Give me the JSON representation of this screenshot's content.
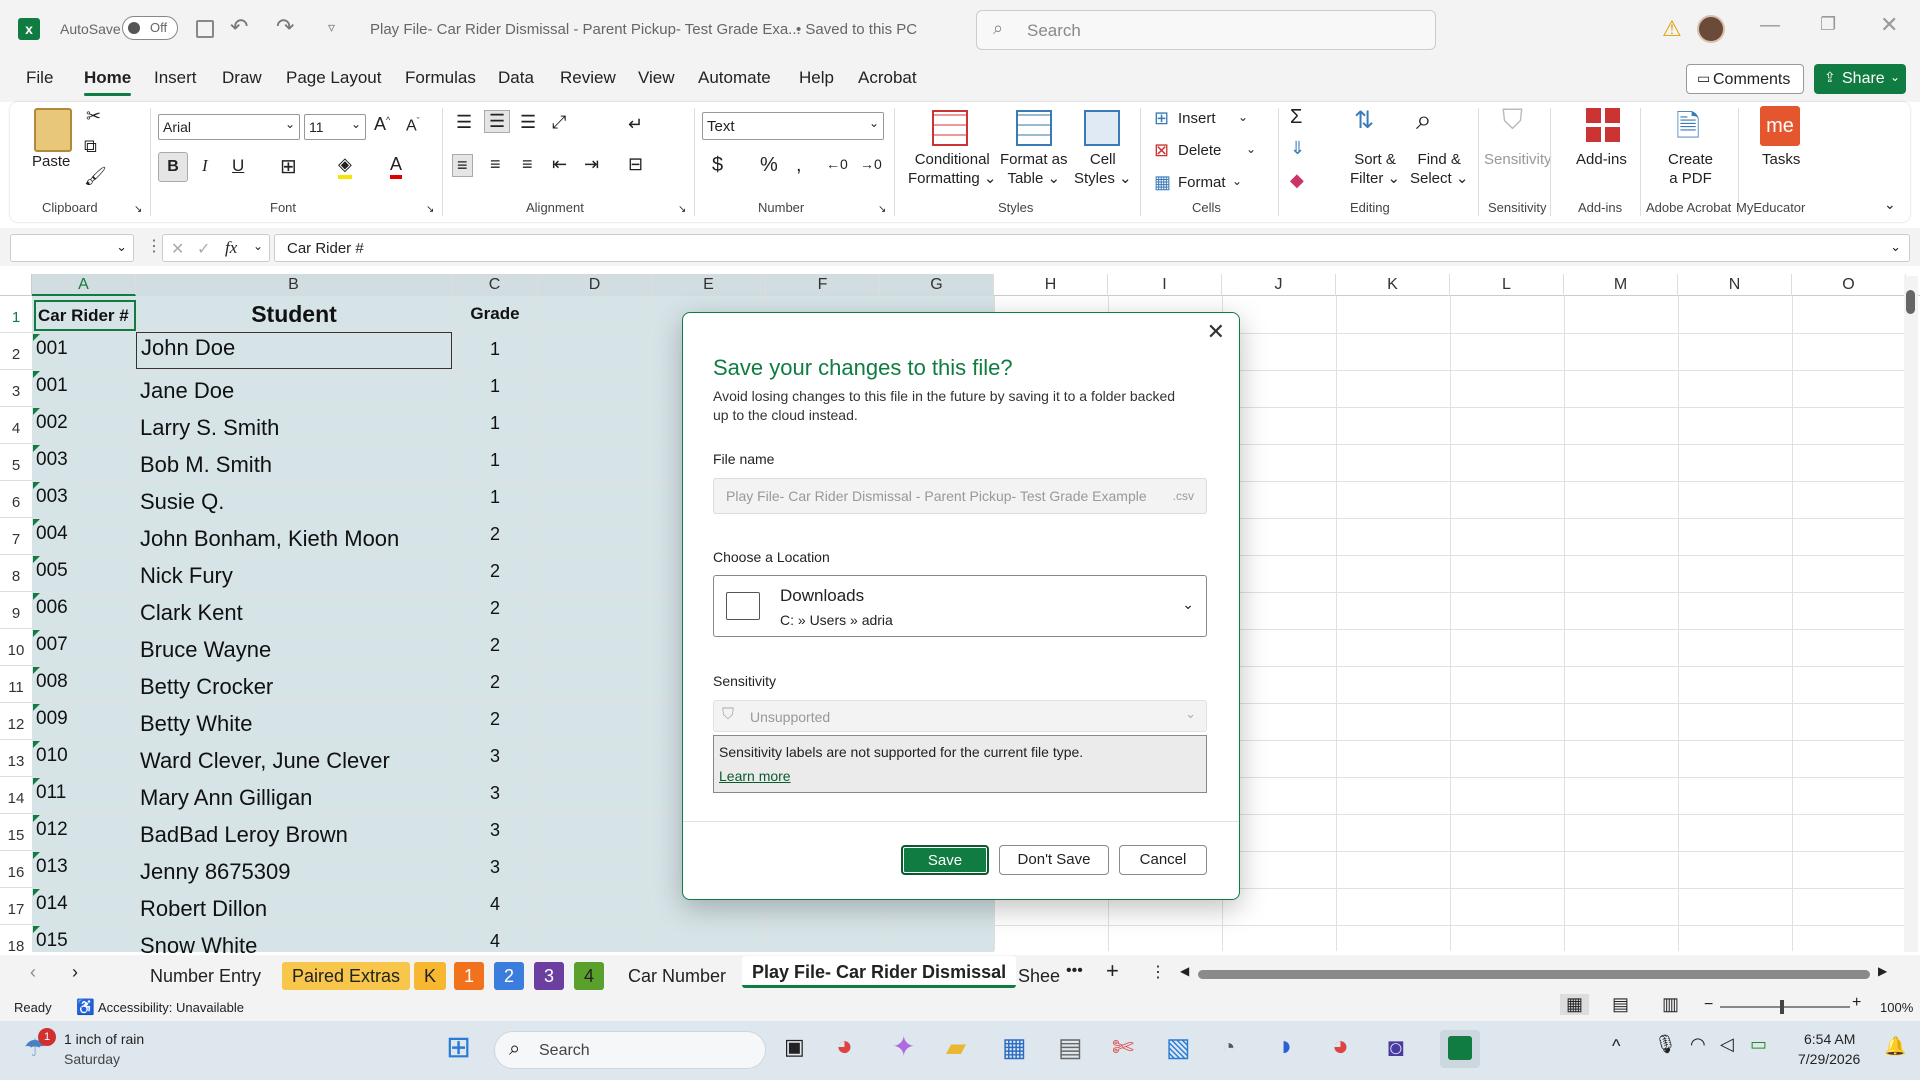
{
  "titlebar": {
    "autosave_label": "AutoSave",
    "autosave_state": "Off",
    "doc_title": "Play File- Car Rider Dismissal - Parent Pickup- Test Grade Exa...",
    "save_state": "• Saved to this PC",
    "search_placeholder": "Search"
  },
  "ribbon_tabs": [
    "File",
    "Home",
    "Insert",
    "Draw",
    "Page Layout",
    "Formulas",
    "Data",
    "Review",
    "View",
    "Automate",
    "Help",
    "Acrobat"
  ],
  "right_buttons": {
    "comments": "Comments",
    "share": "Share"
  },
  "ribbon": {
    "paste": "Paste",
    "font_name": "Arial",
    "font_size": "11",
    "number_format": "Text",
    "conditional": "Conditional",
    "formatting": "Formatting",
    "format_as": "Format as",
    "table": "Table",
    "cell": "Cell",
    "styles": "Styles",
    "insert": "Insert",
    "delete": "Delete",
    "format": "Format",
    "sort": "Sort &",
    "filter": "Filter",
    "find": "Find &",
    "select": "Select",
    "sensitivity": "Sensitivity",
    "addins": "Add-ins",
    "create": "Create",
    "apdf": "a PDF",
    "tasks": "Tasks",
    "me": "me",
    "groups": [
      "Clipboard",
      "Font",
      "Alignment",
      "Number",
      "Styles",
      "Cells",
      "Editing",
      "Sensitivity",
      "Add-ins",
      "Adobe Acrobat",
      "MyEducator"
    ]
  },
  "formula": {
    "fx": "fx",
    "content": "Car Rider #"
  },
  "columns": [
    "A",
    "B",
    "C",
    "D",
    "E",
    "F",
    "G",
    "H",
    "I",
    "J",
    "K",
    "L",
    "M",
    "N",
    "O"
  ],
  "rows": [
    "1",
    "2",
    "3",
    "4",
    "5",
    "6",
    "7",
    "8",
    "9",
    "10",
    "11",
    "12",
    "13",
    "14",
    "15",
    "16",
    "17",
    "18"
  ],
  "headers": {
    "a": "Car Rider #",
    "b": "Student",
    "c": "Grade"
  },
  "data": [
    [
      "001",
      "John  Doe",
      "1"
    ],
    [
      "001",
      "Jane  Doe",
      "1"
    ],
    [
      "002",
      "Larry S. Smith",
      "1"
    ],
    [
      "003",
      "Bob M.  Smith",
      "1"
    ],
    [
      "003",
      "Susie  Q.",
      "1"
    ],
    [
      "004",
      "John Bonham, Kieth Moon",
      "2"
    ],
    [
      "005",
      "Nick Fury",
      "2"
    ],
    [
      "006",
      "Clark  Kent",
      "2"
    ],
    [
      "007",
      "Bruce  Wayne",
      "2"
    ],
    [
      "008",
      "Betty  Crocker",
      "2"
    ],
    [
      "009",
      "Betty  White",
      "2"
    ],
    [
      "010",
      "Ward Clever, June Clever",
      "3"
    ],
    [
      "011",
      "Mary Ann Gilligan",
      "3"
    ],
    [
      "012",
      "BadBad Leroy Brown",
      "3"
    ],
    [
      "013",
      "Jenny  8675309",
      "3"
    ],
    [
      "014",
      "Robert  Dillon",
      "4"
    ],
    [
      "015",
      "Snow  White",
      "4"
    ]
  ],
  "sheets": [
    {
      "label": "Number Entry",
      "bg": "transparent",
      "fg": "#222"
    },
    {
      "label": "Paired Extras",
      "bg": "#f7c64a",
      "fg": "#222"
    },
    {
      "label": "K",
      "bg": "#f7b731",
      "fg": "#222"
    },
    {
      "label": "1",
      "bg": "#f2711c",
      "fg": "#fff"
    },
    {
      "label": "2",
      "bg": "#3b7ddd",
      "fg": "#fff"
    },
    {
      "label": "3",
      "bg": "#6a3fa0",
      "fg": "#fff"
    },
    {
      "label": "4",
      "bg": "#5aa02c",
      "fg": "#222"
    },
    {
      "label": "Car Number",
      "bg": "transparent",
      "fg": "#222"
    },
    {
      "label": "Play File- Car Rider Dismissal",
      "bg": "#fff",
      "fg": "#107c41"
    },
    {
      "label": "Shee",
      "bg": "transparent",
      "fg": "#222"
    }
  ],
  "status": {
    "ready": "Ready",
    "accessibility": "Accessibility: Unavailable",
    "zoom": "100%"
  },
  "taskbar": {
    "weather_title": "1 inch of rain",
    "weather_sub": "Saturday",
    "weather_badge": "1",
    "search": "Search",
    "time": "6:54 AM",
    "date": "7/29/2026"
  },
  "dialog": {
    "title": "Save your changes to this file?",
    "desc": "Avoid losing changes to this file in the future by saving it to a folder backed up to the cloud instead.",
    "file_name_label": "File name",
    "file_name_value": "Play File- Car Rider Dismissal - Parent Pickup- Test Grade Example",
    "file_ext": ".csv",
    "location_label": "Choose a Location",
    "location_name": "Downloads",
    "location_path": "C: » Users » adria",
    "sensitivity_label": "Sensitivity",
    "sensitivity_value": "Unsupported",
    "sensitivity_note": "Sensitivity labels are not supported for the current file type.",
    "learn_more": "Learn more",
    "save": "Save",
    "dont_save": "Don't Save",
    "cancel": "Cancel"
  },
  "colors": {
    "accent": "#107c41",
    "selection": "#d6e4e8"
  }
}
